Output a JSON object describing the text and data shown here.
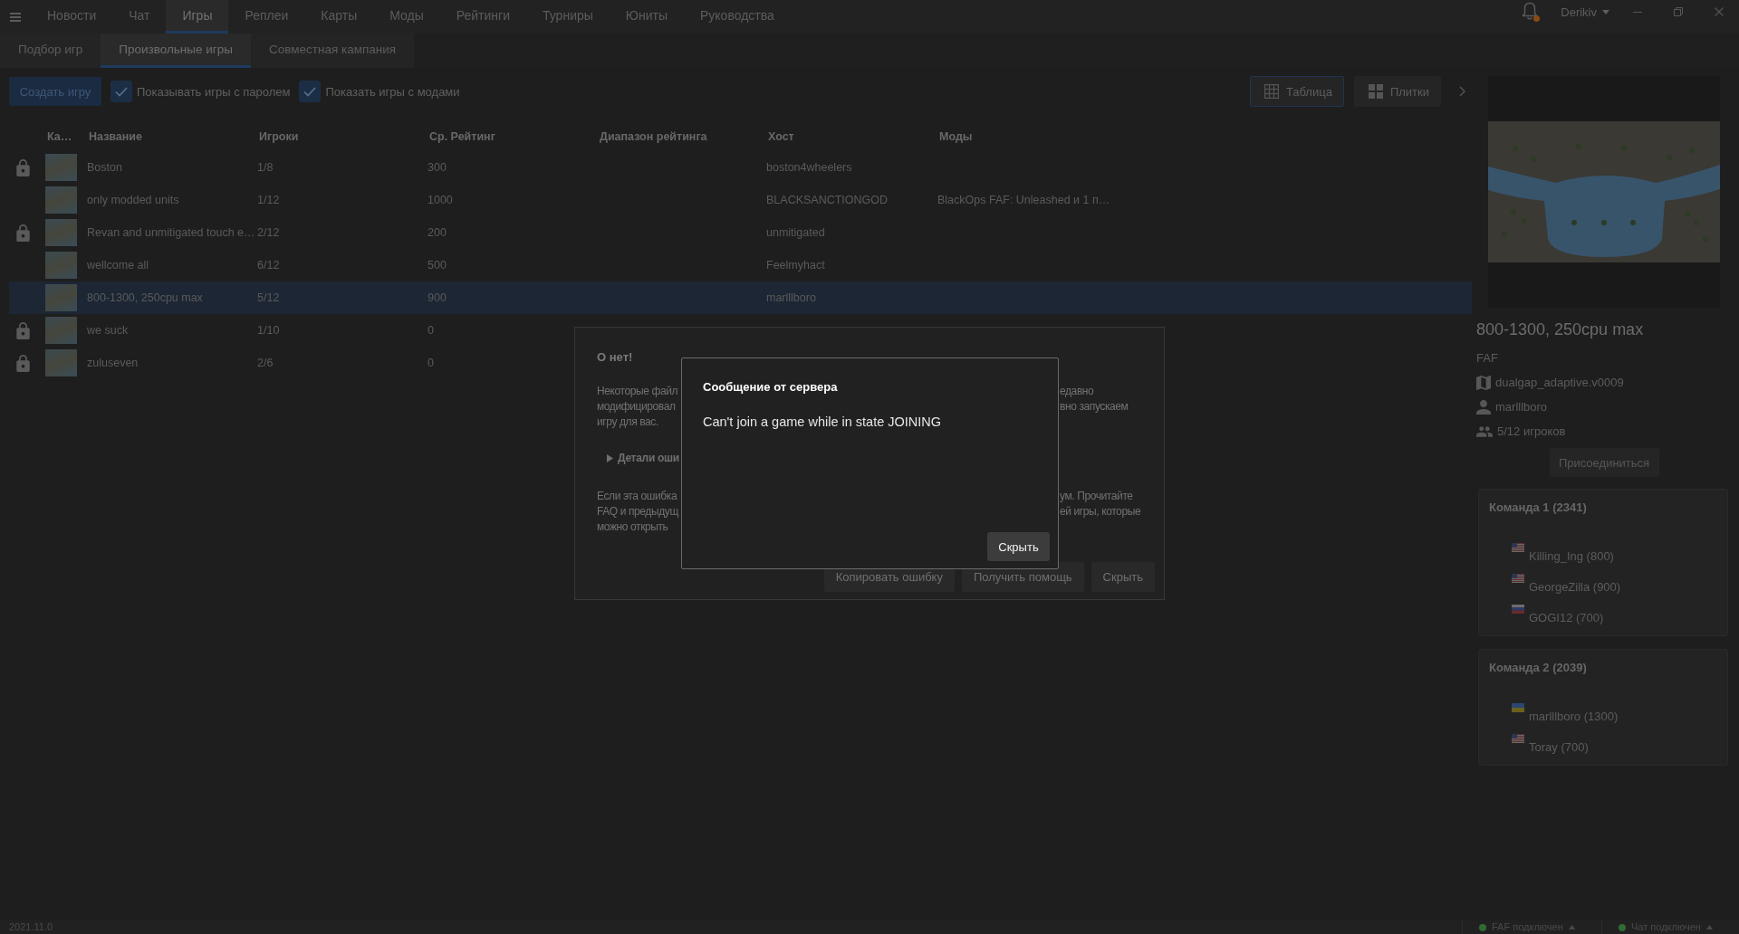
{
  "nav": {
    "tabs": [
      {
        "label": "Новости",
        "selected": false
      },
      {
        "label": "Чат",
        "selected": false
      },
      {
        "label": "Игры",
        "selected": true
      },
      {
        "label": "Реплеи",
        "selected": false
      },
      {
        "label": "Карты",
        "selected": false
      },
      {
        "label": "Моды",
        "selected": false
      },
      {
        "label": "Рейтинги",
        "selected": false
      },
      {
        "label": "Турниры",
        "selected": false
      },
      {
        "label": "Юниты",
        "selected": false
      },
      {
        "label": "Руководства",
        "selected": false
      }
    ],
    "has_notification": true,
    "user": "Derikiv"
  },
  "subtabs": [
    {
      "label": "Подбор игр",
      "selected": false
    },
    {
      "label": "Произвольные игры",
      "selected": true
    },
    {
      "label": "Совместная кампания",
      "selected": false
    }
  ],
  "toolbar": {
    "create_button": "Создать игру",
    "filters": [
      {
        "label": "Показывать игры с паролем",
        "checked": true
      },
      {
        "label": "Показать игры с модами",
        "checked": true
      }
    ],
    "views": [
      {
        "kind": "table",
        "label": "Таблица",
        "selected": true
      },
      {
        "kind": "tiles",
        "label": "Плитки",
        "selected": false
      }
    ]
  },
  "table": {
    "columns": [
      "Ка…",
      "Название",
      "Игроки",
      "Ср. Рейтинг",
      "Диапазон рейтинга",
      "Хост",
      "Моды"
    ],
    "rows": [
      {
        "locked": true,
        "name": "Boston",
        "players": "1/8",
        "avg_rating": "300",
        "host": "boston4wheelers",
        "selected": false
      },
      {
        "locked": false,
        "name": "only modded units",
        "players": "1/12",
        "avg_rating": "1000",
        "host": "BLACKSANCTIONGOD",
        "mods": "BlackOps FAF: Unleashed и 1 п…",
        "selected": false
      },
      {
        "locked": true,
        "name": "Revan and unmitigated touch e…",
        "players": "2/12",
        "avg_rating": "200",
        "host": "unmitigated",
        "selected": false
      },
      {
        "locked": false,
        "name": "wellcome all",
        "players": "6/12",
        "avg_rating": "500",
        "host": "Feelmyhact",
        "selected": false
      },
      {
        "locked": false,
        "name": "800-1300, 250cpu max",
        "players": "5/12",
        "avg_rating": "900",
        "host": "marlllboro",
        "selected": true
      },
      {
        "locked": true,
        "name": "we suck",
        "players": "1/10",
        "avg_rating": "0",
        "selected": false
      },
      {
        "locked": true,
        "name": "zuluseven",
        "players": "2/6",
        "avg_rating": "0",
        "selected": false
      }
    ]
  },
  "details": {
    "title": "800-1300, 250cpu max",
    "featured_mod": "FAF",
    "map": "dualgap_adaptive.v0009",
    "host": "marlllboro",
    "players": "5/12 игроков",
    "join_button": "Присоединиться",
    "teams": [
      {
        "title": "Команда 1 (2341)",
        "players": [
          {
            "kind": "us",
            "name": "Killing_Ing (800)"
          },
          {
            "kind": "us",
            "name": "GeorgeZilla (900)"
          },
          {
            "kind": "ru",
            "name": "GOGI12 (700)"
          }
        ]
      },
      {
        "title": "Команда 2 (2039)",
        "players": [
          {
            "kind": "ua",
            "name": "marlllboro (1300)"
          },
          {
            "kind": "us",
            "name": "Toray (700)"
          }
        ]
      }
    ]
  },
  "error_dialog": {
    "title": "О нет!",
    "intro_lines": [
      {
        "left": "Некоторые файл",
        "right": "едавно"
      },
      {
        "left": "модифицировал",
        "right": "вно запускаем"
      },
      {
        "left": "игру для вас."
      }
    ],
    "details_label": "Детали оши",
    "details_expanded": false,
    "help_lines": [
      {
        "left": "Если эта ошибка",
        "right": "ум. Прочитайте"
      },
      {
        "left": "FAQ и предыдущ",
        "right": "ей игры, которые"
      },
      {
        "left": "можно открыть"
      }
    ],
    "buttons": [
      "Копировать ошибку",
      "Получить помощь",
      "Скрыть"
    ]
  },
  "server_dialog": {
    "title": "Сообщение от сервера",
    "message": "Can't join a game while in state JOINING",
    "button": "Скрыть"
  },
  "status_bar": {
    "version": "2021.11.0",
    "connections": [
      {
        "label": "FAF подключен",
        "connected": true
      },
      {
        "label": "Чат подключен",
        "connected": true
      }
    ]
  }
}
